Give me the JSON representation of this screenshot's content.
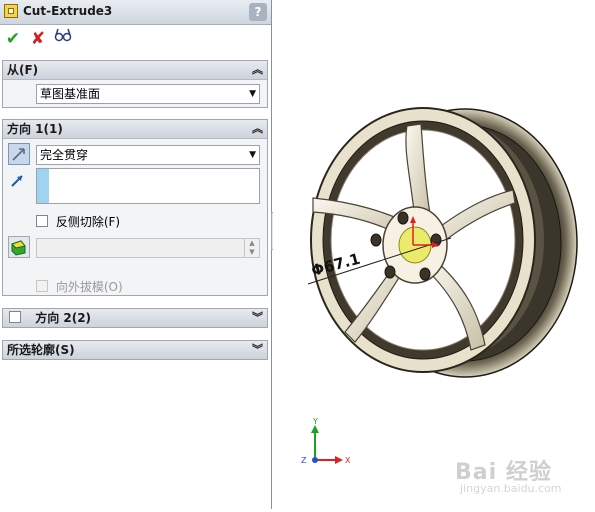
{
  "property_manager": {
    "title": "Cut-Extrude3",
    "help_label": "?",
    "actions": {
      "ok_icon": "checkmark-icon",
      "cancel_icon": "x-icon",
      "preview_icon": "glasses-icon"
    },
    "from_section": {
      "header": "从(F)",
      "start_condition": "草图基准面"
    },
    "direction1_section": {
      "header": "方向 1(1)",
      "end_condition": "完全贯穿",
      "flip_side_label": "反侧切除(F)",
      "flip_side_checked": false,
      "draft_outward_label": "向外拔模(O)",
      "draft_outward_enabled": false
    },
    "direction2_section": {
      "header": "方向 2(2)",
      "checked": false
    },
    "selected_contours_section": {
      "header": "所选轮廓(S)"
    }
  },
  "graphics": {
    "dimension_label": "Φ67.1",
    "triad": {
      "x": "X",
      "y": "Y",
      "z": "Z"
    },
    "colors": {
      "wheel_face": "#f1ead8",
      "wheel_shadow": "#6e6450",
      "axis_x": "#e02020",
      "axis_y": "#20a020",
      "axis_z": "#2050d0"
    }
  },
  "watermark": {
    "brand": "Bai 经验",
    "url": "jingyan.baidu.com"
  }
}
